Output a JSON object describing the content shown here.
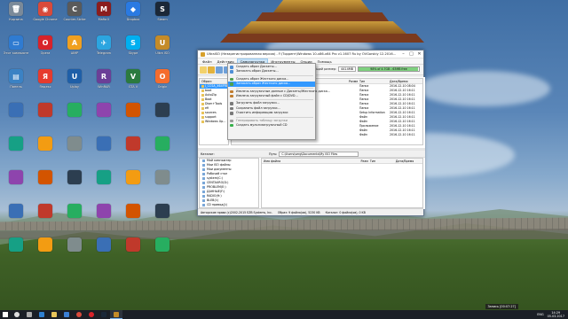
{
  "window": {
    "title": "UltraISO (Незарегистрированная версия) - F:\\Торрент\\Windows 10-x86-x64 Pro v1.1607 Ru by OVGorskiy 12.2016...",
    "minimize_glyph": "–",
    "maximize_glyph": "□",
    "close_glyph": "✕",
    "menus": [
      "Файл",
      "Действия",
      "Самозагрузка",
      "Инструменты",
      "Опции",
      "Помощь"
    ],
    "active_menu_index": 2,
    "size_label": "Общий размер:",
    "size_value": "4414MB",
    "size_bar_text": "98% of 4.7GB - 63MB free",
    "size_bar_fill": 0.98
  },
  "dropdown": {
    "items": [
      {
        "label": "Создать образ Дискеты...",
        "icon_color": "#4f8fd6",
        "type": "item"
      },
      {
        "label": "Записать образ Дискеты...",
        "icon_color": "#4f8fd6",
        "type": "item"
      },
      {
        "type": "sep"
      },
      {
        "label": "Создать образ Жесткого диска...",
        "icon_color": "#4fa04f",
        "type": "item"
      },
      {
        "label": "Записать образ Жесткого диска...",
        "icon_color": "#4fa04f",
        "type": "item",
        "highlight": true
      },
      {
        "type": "sep"
      },
      {
        "label": "Извлечь загрузочные данные с Дискеты/Жесткого диска...",
        "icon_color": "#c07d2f",
        "type": "item"
      },
      {
        "label": "Извлечь загрузочный файл с CD/DVD...",
        "icon_color": "#c07d2f",
        "type": "item"
      },
      {
        "type": "sep"
      },
      {
        "label": "Загрузить файл загрузки...",
        "icon_color": "#7a7a7a",
        "type": "item"
      },
      {
        "label": "Сохранить файл загрузки...",
        "icon_color": "#7a7a7a",
        "type": "item"
      },
      {
        "label": "Очистить информацию загрузки",
        "icon_color": "#7a7a7a",
        "type": "item"
      },
      {
        "type": "sep"
      },
      {
        "label": "Генерировать таблицу загрузки",
        "icon_color": "#9a9a9a",
        "type": "item",
        "dim": true
      },
      {
        "label": "Создать мультизагрузочный CD",
        "icon_color": "#36b04a",
        "type": "item"
      }
    ]
  },
  "top_pane": {
    "tree_header": "Образ:",
    "tree_nodes": [
      {
        "label": "J_CCSA_X64FRE",
        "selected": true
      },
      {
        "label": "boot",
        "selected": false
      },
      {
        "label": "AutoZip",
        "selected": false
      },
      {
        "label": "Boot",
        "selected": false
      },
      {
        "label": "Dism+Tools",
        "selected": false
      },
      {
        "label": "efi",
        "selected": false
      },
      {
        "label": "sources",
        "selected": false
      },
      {
        "label": "support",
        "selected": false
      },
      {
        "label": "Windows Up...",
        "selected": false
      }
    ],
    "columns": [
      "Имя файла",
      "Размер",
      "Тип",
      "Дата/Время"
    ],
    "rows": [
      [
        "",
        "",
        "Папка",
        "2016-12-10 08:04"
      ],
      [
        "",
        "",
        "Папка",
        "2016-12-10 16:11"
      ],
      [
        "",
        "",
        "Папка",
        "2016-12-10 16:11"
      ],
      [
        "",
        "",
        "Папка",
        "2016-12-10 16:11"
      ],
      [
        "",
        "",
        "Папка",
        "2016-12-10 16:11"
      ],
      [
        "",
        "",
        "Папка",
        "2016-12-10 16:11"
      ],
      [
        "",
        "",
        "Setup Information",
        "2016-12-10 16:11"
      ],
      [
        "",
        "",
        "Файл",
        "2016-12-10 16:11"
      ],
      [
        "",
        "",
        "Файл",
        "2016-12-10 16:11"
      ],
      [
        "",
        "",
        "Приложение",
        "2016-12-10 16:11"
      ],
      [
        "",
        "",
        "Файл",
        "2016-12-10 16:11"
      ],
      [
        "",
        "",
        "Файл",
        "2016-12-10 16:11"
      ]
    ]
  },
  "lower_bar": {
    "label": "Каталог:",
    "path_label": "Путь:",
    "path_value": "C:\\Users\\serg\\Documents\\My ISO Files"
  },
  "bottom_pane": {
    "tree_nodes": [
      "Мой компьютер",
      "Мои ISO файлы",
      "Мои документы",
      "Рабочий стол",
      "system(C:)",
      "CENTAURO(D:)",
      "PROBLEM(E:)",
      "ДАННЫЕ(F:)",
      "RADIO(H:)",
      "BLEB(I:)",
      "CD привод(J:)",
      "CD привод(K:)"
    ],
    "columns": [
      "Имя файла",
      "Размер",
      "Тип",
      "Дата/Время"
    ]
  },
  "statusbar": {
    "copyright": "Авторские права (c)2002-2015 EZB Systems, Inc.",
    "image_info": "Образ: 9 файла(ов), 5230 KB",
    "catalog_info": "Каталог: 0 файла(ов), 0 KB"
  },
  "desktop_icons": [
    {
      "label": "Корзина",
      "color": "#7b8a99",
      "glyph": "🗑"
    },
    {
      "label": "Google Chrome",
      "color": "#d94a3b",
      "glyph": "◉"
    },
    {
      "label": "Counter-Strike",
      "color": "#5a5a5a",
      "glyph": "C"
    },
    {
      "label": "Mafia II",
      "color": "#8b1d1d",
      "glyph": "M"
    },
    {
      "label": "Dropbox",
      "color": "#2a7ae2",
      "glyph": "◆"
    },
    {
      "label": "Steam",
      "color": "#1b2838",
      "glyph": "S"
    },
    {
      "label": "Этот компьютер",
      "color": "#2f7bd1",
      "glyph": "▭"
    },
    {
      "label": "Opera",
      "color": "#d8232a",
      "glyph": "O"
    },
    {
      "label": "AIMP",
      "color": "#f0a020",
      "glyph": "A"
    },
    {
      "label": "Telegram",
      "color": "#2ca5e0",
      "glyph": "✈"
    },
    {
      "label": "Skype",
      "color": "#00aff0",
      "glyph": "S"
    },
    {
      "label": "Ultra ISO",
      "color": "#c48b28",
      "glyph": "U"
    },
    {
      "label": "Панель",
      "color": "#3b82c4",
      "glyph": "▤"
    },
    {
      "label": "Яндекс",
      "color": "#e63b2e",
      "glyph": "Я"
    },
    {
      "label": "Uplay",
      "color": "#1f5fa8",
      "glyph": "U"
    },
    {
      "label": "WinRAR",
      "color": "#6b3f97",
      "glyph": "R"
    },
    {
      "label": "GTA V",
      "color": "#2b7a3f",
      "glyph": "V"
    },
    {
      "label": "Origin",
      "color": "#f56c2d",
      "glyph": "O"
    }
  ],
  "taskbar": {
    "time": "14:29",
    "date": "05.03.2017",
    "lang": "ENG",
    "tray_tip": "Запись [00:07:27]"
  }
}
